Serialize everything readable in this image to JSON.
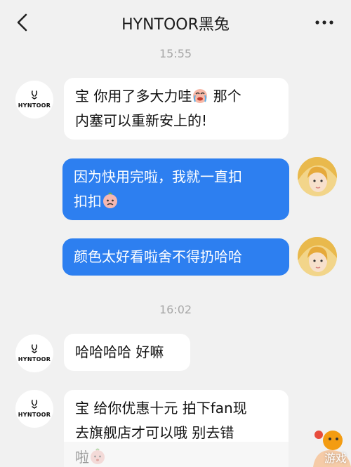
{
  "header": {
    "title": "HYNTOOR黑兔",
    "back_icon": "chevron-left-icon",
    "more_icon": "more-horizontal-icon"
  },
  "brand": {
    "avatar_text": "HYNTOOR"
  },
  "timestamps": [
    "15:55",
    "16:02"
  ],
  "messages": [
    {
      "side": "in",
      "line1": "宝 你用了多大力哇",
      "line1b": "那个",
      "line2": "内塞可以重新安上的!"
    },
    {
      "side": "out",
      "line1": "因为快用完啦，我就一直扣",
      "line2": "扣扣"
    },
    {
      "side": "out",
      "line1": "颜色太好看啦舍不得扔哈哈"
    },
    {
      "side": "in",
      "line1": "哈哈哈哈 好嘛"
    },
    {
      "side": "in",
      "line1": "宝 给你优惠十元 拍下fan现",
      "line2": "去旗舰店才可以哦 别去错",
      "line3": "啦"
    }
  ],
  "watermark": "游戏",
  "colors": {
    "background": "#f1f1f1",
    "outgoing": "#2d7ff0",
    "incoming": "#ffffff",
    "timestamp": "#a7a7a7"
  }
}
